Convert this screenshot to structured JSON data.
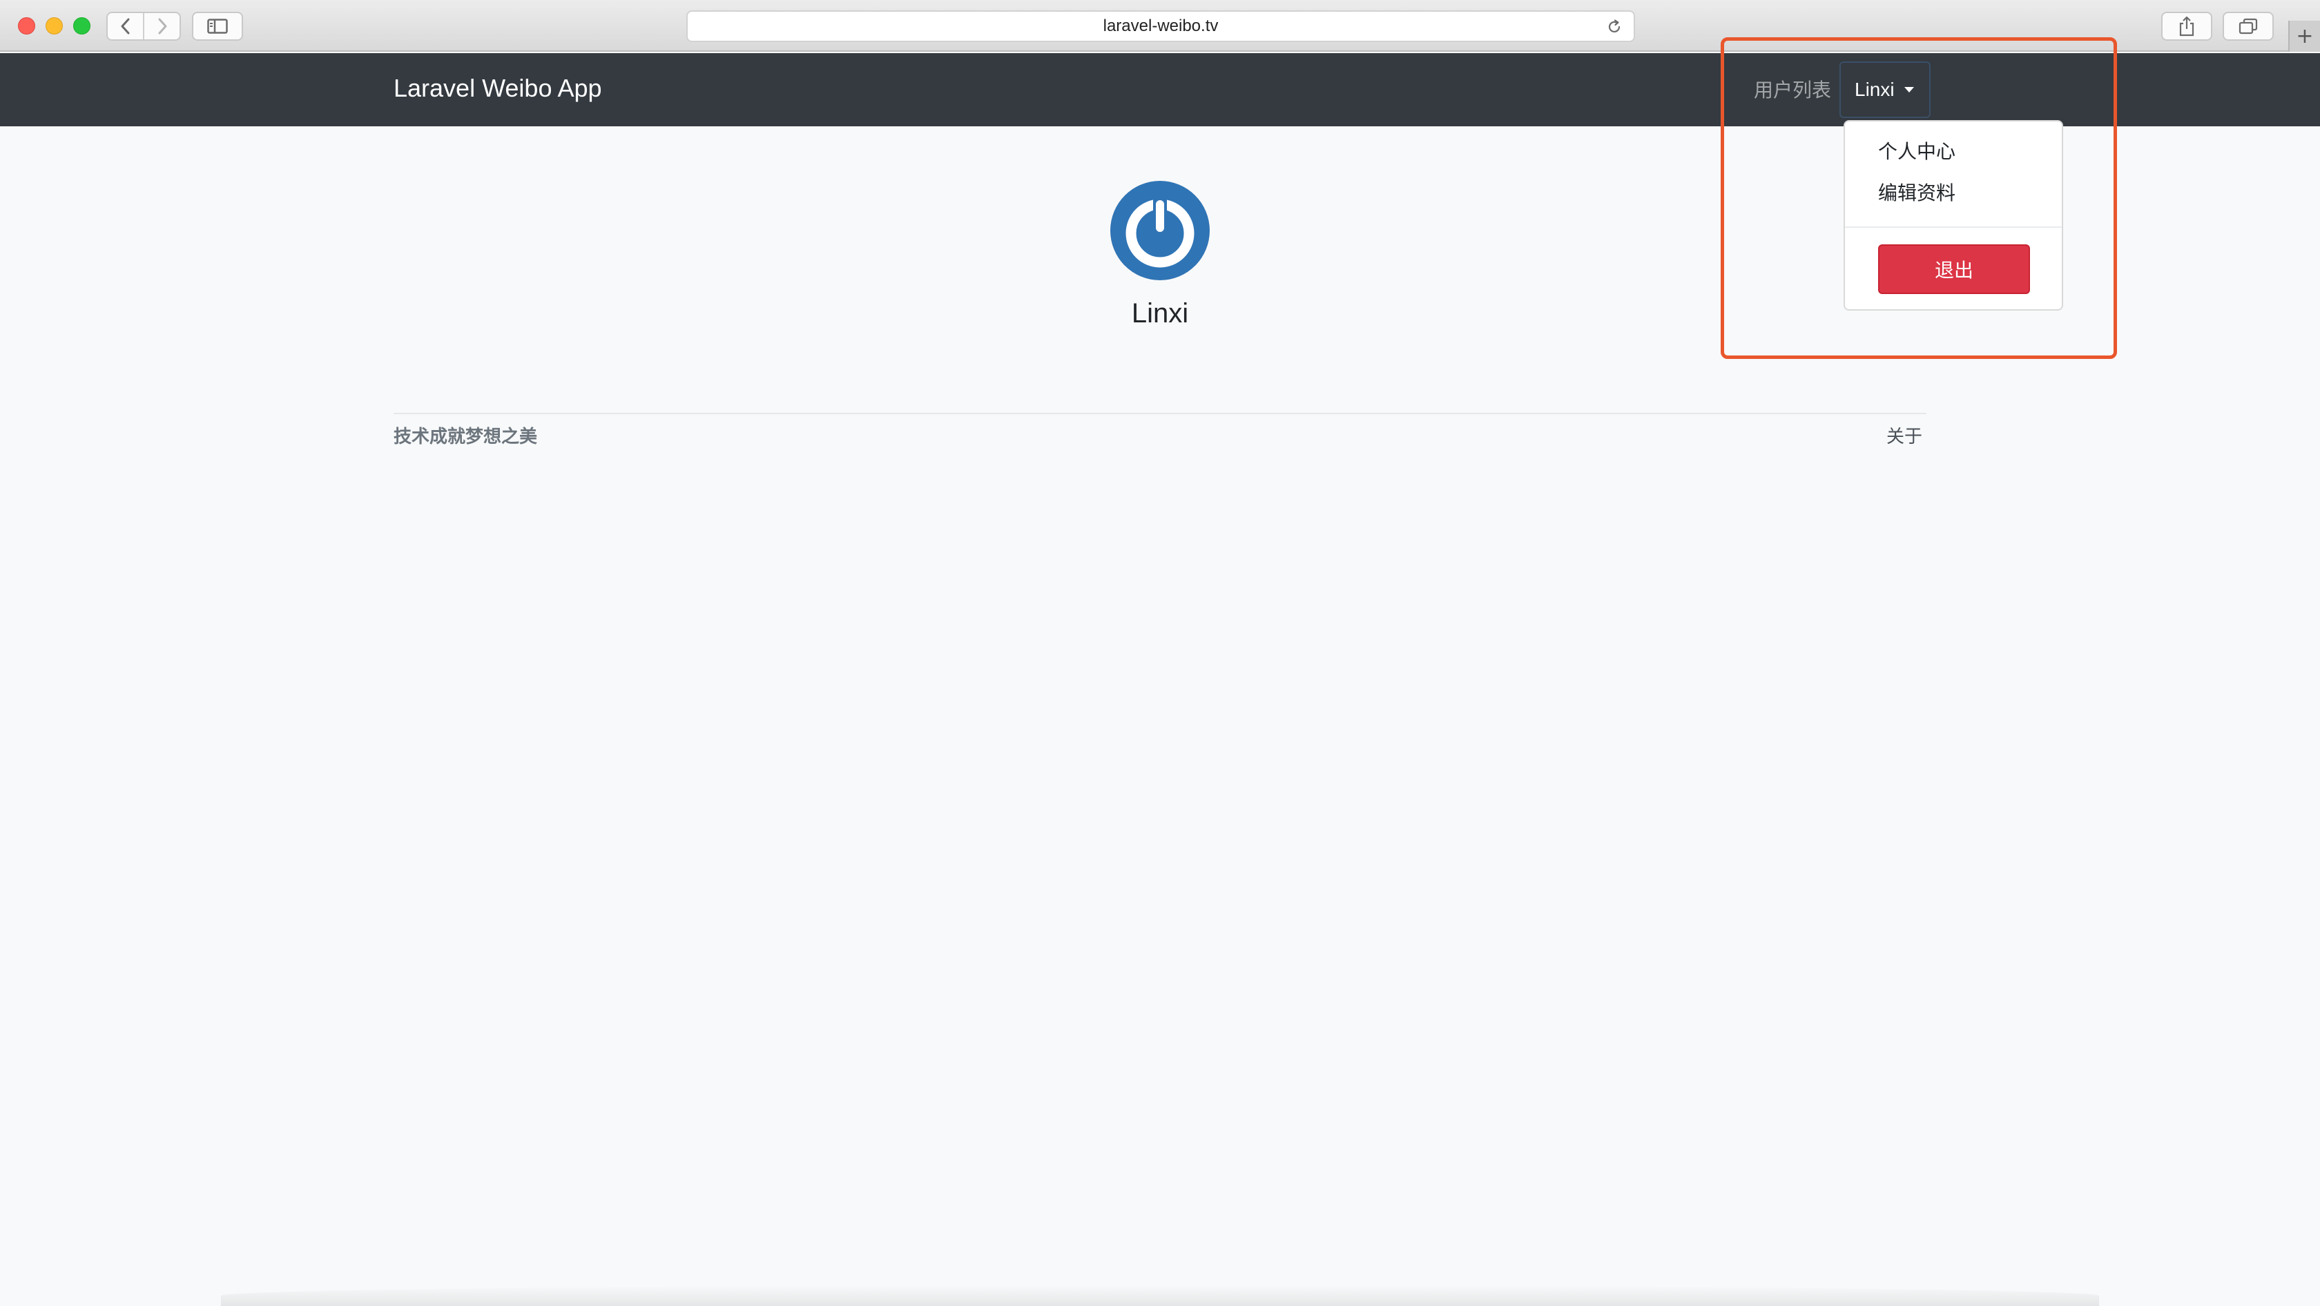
{
  "browser": {
    "url": "laravel-weibo.tv",
    "new_tab_label": "+"
  },
  "navbar": {
    "brand": "Laravel Weibo App",
    "users_link": "用户列表",
    "current_user": "Linxi"
  },
  "dropdown": {
    "items": [
      "个人中心",
      "编辑资料"
    ],
    "logout_label": "退出"
  },
  "profile": {
    "name": "Linxi"
  },
  "footer": {
    "slogan": "技术成就梦想之美",
    "about": "关于"
  },
  "colors": {
    "navbar_bg": "#343a40",
    "logout_bg": "#dc3545",
    "highlight": "#e9562c",
    "avatar_blue": "#2f74b5",
    "page_bg": "#f8f9fa"
  },
  "icons": {
    "back": "chevron-left-icon",
    "forward": "chevron-right-icon",
    "sidebar": "sidebar-icon",
    "reload": "reload-icon",
    "share": "share-icon",
    "tabs": "tabs-icon",
    "caret": "caret-down-icon",
    "avatar": "gravatar-power-icon"
  }
}
